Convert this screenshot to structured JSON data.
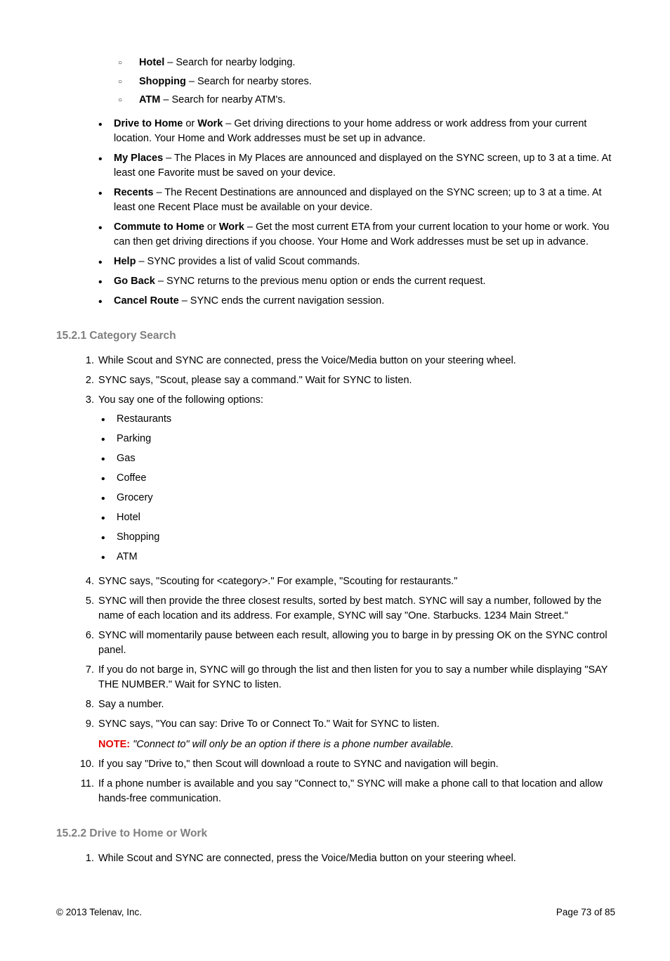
{
  "sub_items": [
    {
      "bold": "Hotel",
      "text": " – Search for nearby lodging."
    },
    {
      "bold": "Shopping",
      "text": " – Search for nearby stores."
    },
    {
      "bold": "ATM",
      "text": " – Search for nearby ATM's."
    }
  ],
  "bullets": [
    {
      "bold": "Drive to Home",
      "mid_plain": " or ",
      "bold2": "Work",
      "text": " – Get driving directions to your home address or work address from your current location. Your Home and Work addresses must be set up in advance."
    },
    {
      "bold": "My Places",
      "text": " – The Places in My Places are announced and displayed on the SYNC screen, up to 3 at a time. At least one Favorite must be saved on your device."
    },
    {
      "bold": "Recents",
      "text": " – The Recent Destinations are announced and displayed on the SYNC screen; up to 3 at a time. At least one Recent Place must be available on your device."
    },
    {
      "bold": "Commute to Home",
      "mid_plain": " or ",
      "bold2": "Work",
      "text": " – Get the most current ETA from your current location to your home or work. You can then get driving directions if you choose. Your Home and Work addresses must be set up in advance."
    },
    {
      "bold": "Help",
      "text": " – SYNC provides a list of valid Scout commands."
    },
    {
      "bold": "Go Back",
      "text": " – SYNC returns to the previous menu option or ends the current request."
    },
    {
      "bold": "Cancel Route",
      "text": " – SYNC ends the current navigation session."
    }
  ],
  "section1_heading": "15.2.1 Category Search",
  "ol1": {
    "i1": "While Scout and SYNC are connected, press the Voice/Media button on your steering wheel.",
    "i2": "SYNC says, \"Scout, please say a command.\" Wait for SYNC to listen.",
    "i3": "You say one of the following options:",
    "i3_sub": [
      "Restaurants",
      "Parking",
      "Gas",
      "Coffee",
      "Grocery",
      "Hotel",
      "Shopping",
      "ATM"
    ],
    "i4": "SYNC says, \"Scouting for <category>.\" For example, \"Scouting for restaurants.\"",
    "i5": "SYNC will then provide the three closest results, sorted by best match. SYNC will say a number, followed by the name of each location and its address. For example, SYNC will say \"One. Starbucks. 1234 Main Street.\"",
    "i6": "SYNC will momentarily pause between each result, allowing you to barge in by pressing OK on the SYNC control panel.",
    "i7": "If you do not barge in, SYNC will go through the list and then listen for you to say a number while displaying \"SAY THE NUMBER.\" Wait for SYNC to listen.",
    "i8": "Say a number.",
    "i9": "SYNC says, \"You can say: Drive To or Connect To.\" Wait for SYNC to listen.",
    "note_label": "NOTE:",
    "note_text": " \"Connect to\" will only be an option if there is a phone number available.",
    "i10": "If you say \"Drive to,\" then Scout will download a route to SYNC and navigation will begin.",
    "i11": "If a phone number is available and you say \"Connect to,\" SYNC will make a phone call to that location and allow hands-free communication."
  },
  "section2_heading": "15.2.2 Drive to Home or Work",
  "ol2": {
    "i1": "While Scout and SYNC are connected, press the Voice/Media button on your steering wheel."
  },
  "footer_left": "© 2013 Telenav, Inc.",
  "footer_right": "Page 73 of 85"
}
